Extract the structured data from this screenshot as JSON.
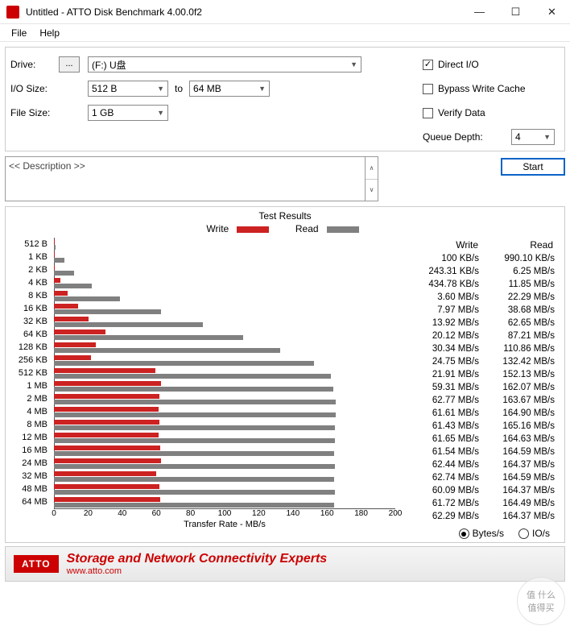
{
  "window": {
    "title": "Untitled - ATTO Disk Benchmark 4.00.0f2"
  },
  "menu": {
    "file": "File",
    "help": "Help"
  },
  "form": {
    "drive_label": "Drive:",
    "drive_btn": "...",
    "drive_value": "(F:) U盘",
    "iosize_label": "I/O Size:",
    "iosize_from": "512 B",
    "to": "to",
    "iosize_to": "64 MB",
    "filesize_label": "File Size:",
    "filesize_value": "1 GB",
    "direct_io": "Direct I/O",
    "bypass": "Bypass Write Cache",
    "verify": "Verify Data",
    "queue_label": "Queue Depth:",
    "queue_value": "4",
    "description": "<< Description >>",
    "start": "Start"
  },
  "results": {
    "title": "Test Results",
    "write_legend": "Write",
    "read_legend": "Read",
    "write_col": "Write",
    "read_col": "Read",
    "xlabel": "Transfer Rate - MB/s",
    "bytes_label": "Bytes/s",
    "ios_label": "IO/s"
  },
  "chart_data": {
    "type": "bar",
    "xlabel": "Transfer Rate - MB/s",
    "xlim": [
      0,
      200
    ],
    "xticks": [
      0,
      20,
      40,
      60,
      80,
      100,
      120,
      140,
      160,
      180,
      200
    ],
    "categories": [
      "512 B",
      "1 KB",
      "2 KB",
      "4 KB",
      "8 KB",
      "16 KB",
      "32 KB",
      "64 KB",
      "128 KB",
      "256 KB",
      "512 KB",
      "1 MB",
      "2 MB",
      "4 MB",
      "8 MB",
      "12 MB",
      "16 MB",
      "24 MB",
      "32 MB",
      "48 MB",
      "64 MB"
    ],
    "series": [
      {
        "name": "Write",
        "color": "#cc2222",
        "values": [
          0.1,
          0.24,
          0.43,
          3.6,
          7.97,
          13.92,
          20.12,
          30.34,
          24.75,
          21.91,
          59.31,
          62.77,
          61.61,
          61.43,
          61.65,
          61.54,
          62.44,
          62.74,
          60.09,
          61.72,
          62.29
        ]
      },
      {
        "name": "Read",
        "color": "#808080",
        "values": [
          0.99,
          6.25,
          11.85,
          22.29,
          38.68,
          62.65,
          87.21,
          110.86,
          132.42,
          152.13,
          162.07,
          163.67,
          164.9,
          165.16,
          164.63,
          164.59,
          164.37,
          164.59,
          164.37,
          164.49,
          164.37
        ]
      }
    ],
    "table": {
      "write": [
        "100 KB/s",
        "243.31 KB/s",
        "434.78 KB/s",
        "3.60 MB/s",
        "7.97 MB/s",
        "13.92 MB/s",
        "20.12 MB/s",
        "30.34 MB/s",
        "24.75 MB/s",
        "21.91 MB/s",
        "59.31 MB/s",
        "62.77 MB/s",
        "61.61 MB/s",
        "61.43 MB/s",
        "61.65 MB/s",
        "61.54 MB/s",
        "62.44 MB/s",
        "62.74 MB/s",
        "60.09 MB/s",
        "61.72 MB/s",
        "62.29 MB/s"
      ],
      "read": [
        "990.10 KB/s",
        "6.25 MB/s",
        "11.85 MB/s",
        "22.29 MB/s",
        "38.68 MB/s",
        "62.65 MB/s",
        "87.21 MB/s",
        "110.86 MB/s",
        "132.42 MB/s",
        "152.13 MB/s",
        "162.07 MB/s",
        "163.67 MB/s",
        "164.90 MB/s",
        "165.16 MB/s",
        "164.63 MB/s",
        "164.59 MB/s",
        "164.37 MB/s",
        "164.59 MB/s",
        "164.37 MB/s",
        "164.49 MB/s",
        "164.37 MB/s"
      ]
    }
  },
  "banner": {
    "logo": "ATTO",
    "tagline": "Storage and Network Connectivity Experts",
    "url": "www.atto.com"
  },
  "watermark": "值 什么值得买"
}
